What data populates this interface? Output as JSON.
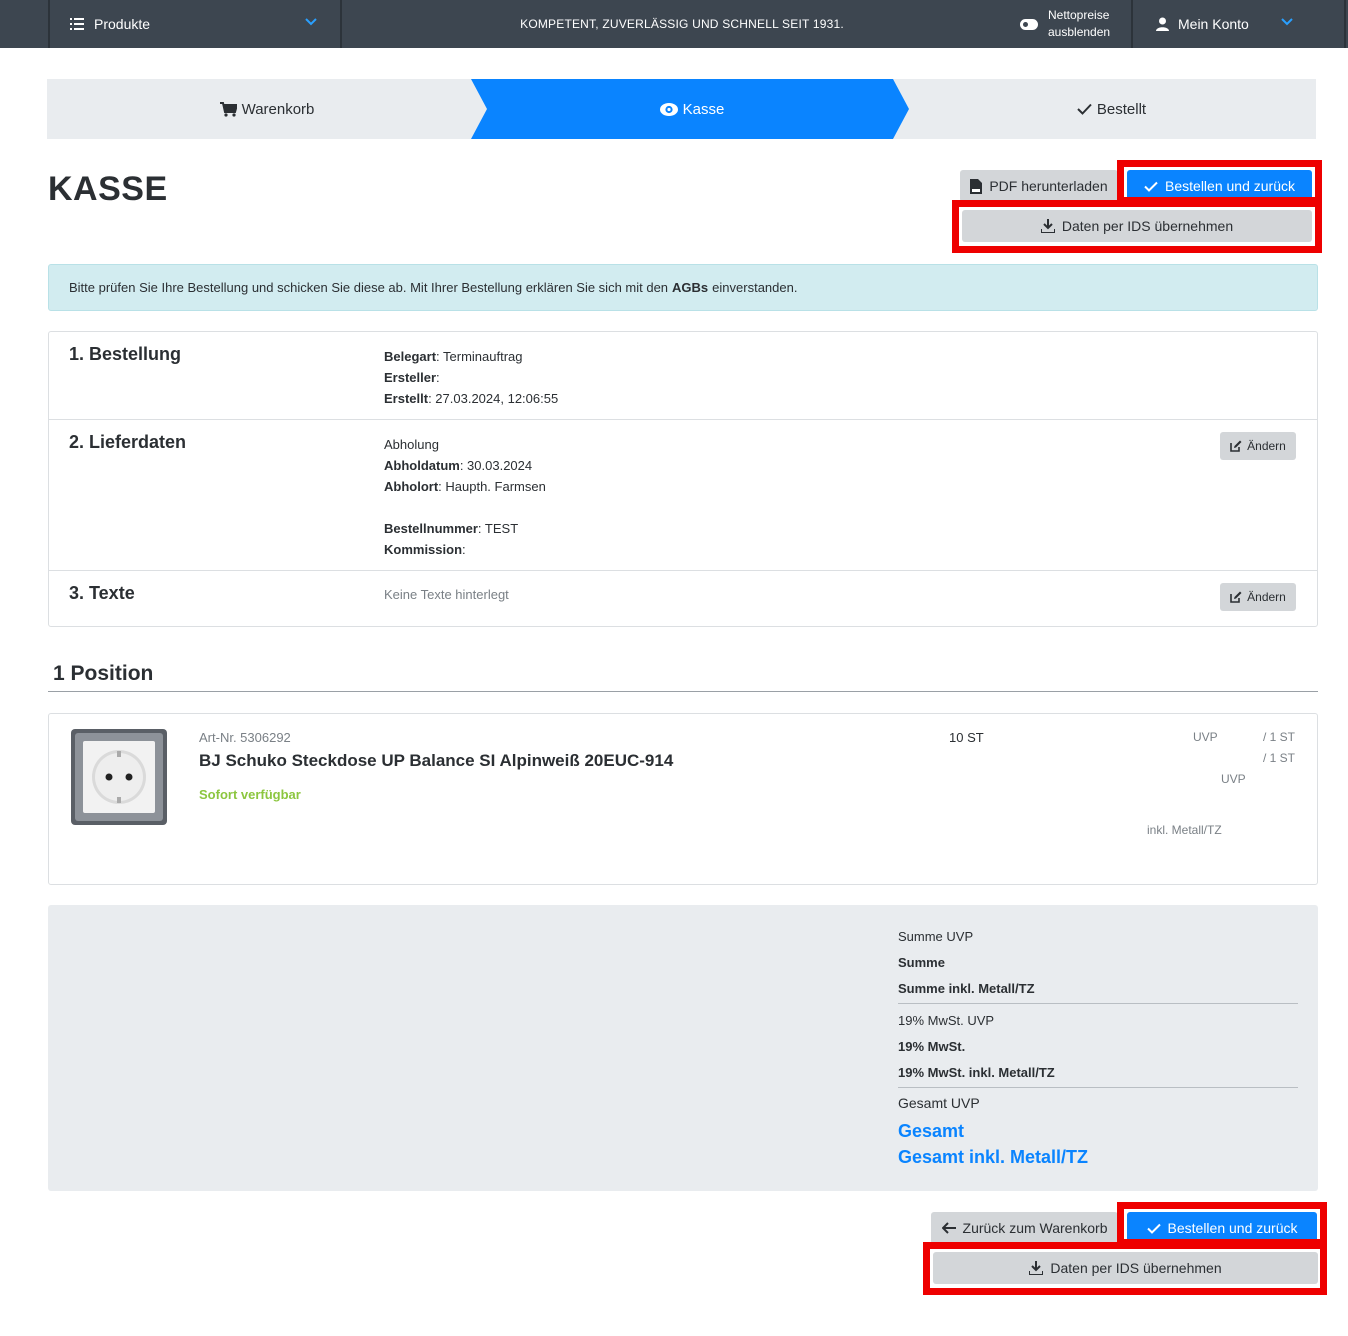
{
  "topbar": {
    "products_label": "Produkte",
    "slogan": "KOMPETENT, ZUVERLÄSSIG UND SCHNELL SEIT 1931.",
    "netto_line1": "Nettopreise",
    "netto_line2": "ausblenden",
    "account_label": "Mein Konto"
  },
  "stepper": {
    "step1": "Warenkorb",
    "step2": "Kasse",
    "step3": "Bestellt"
  },
  "page": {
    "title": "KASSE"
  },
  "actions_top": {
    "pdf": "PDF herunterladen",
    "order": "Bestellen und zurück",
    "ids": "Daten per IDS übernehmen"
  },
  "alert": {
    "text_before": "Bitte prüfen Sie Ihre Bestellung und schicken Sie diese ab. Mit Ihrer Bestellung erklären Sie sich mit den",
    "bold": "AGBs",
    "text_after": "einverstanden."
  },
  "bestellung": {
    "heading": "1. Bestellung",
    "belegart_label": "Belegart",
    "belegart_value": ": Terminauftrag",
    "ersteller_label": "Ersteller",
    "ersteller_value": ":",
    "erstellt_label": "Erstellt",
    "erstellt_value": ": 27.03.2024, 12:06:55"
  },
  "lieferdaten": {
    "heading": "2. Lieferdaten",
    "mode": "Abholung",
    "abholdatum_label": "Abholdatum",
    "abholdatum_value": ": 30.03.2024",
    "abholort_label": "Abholort",
    "abholort_value": ": Haupth. Farmsen",
    "bestellnummer_label": "Bestellnummer",
    "bestellnummer_value": ": TEST",
    "kommission_label": "Kommission",
    "kommission_value": ":",
    "edit_label": "Ändern"
  },
  "texte": {
    "heading": "3. Texte",
    "empty": "Keine Texte hinterlegt",
    "edit_label": "Ändern"
  },
  "positions": {
    "heading": "1 Position",
    "item": {
      "artnr": "Art-Nr. 5306292",
      "name": "BJ Schuko Steckdose UP Balance SI Alpinweiß 20EUC-914",
      "availability": "Sofort verfügbar",
      "quantity": "10 ST",
      "uvp_label": "UVP",
      "per_unit_1": "/ 1 ST",
      "per_unit_2": "/ 1 ST",
      "uvp_label_2": "UVP",
      "metall_label": "inkl. Metall/TZ"
    }
  },
  "summary": {
    "summe_uvp": "Summe UVP",
    "summe": "Summe",
    "summe_metall": "Summe inkl. Metall/TZ",
    "mwst_uvp": "19% MwSt. UVP",
    "mwst": "19% MwSt.",
    "mwst_metall": "19% MwSt. inkl. Metall/TZ",
    "gesamt_uvp": "Gesamt UVP",
    "gesamt": "Gesamt",
    "gesamt_metall": "Gesamt inkl. Metall/TZ"
  },
  "actions_bottom": {
    "back": "Zurück zum Warenkorb",
    "order": "Bestellen und zurück",
    "ids": "Daten per IDS übernehmen"
  },
  "colors": {
    "topbar": "#3d4650",
    "primary": "#0a84ff",
    "highlight": "#ee0000",
    "available": "#8cc63f"
  },
  "icons": [
    "list-icon",
    "chevron-down-icon",
    "toggle-icon",
    "user-icon",
    "cart-icon",
    "eye-icon",
    "check-icon",
    "pdf-icon",
    "download-icon",
    "edit-icon",
    "arrow-left-icon"
  ]
}
